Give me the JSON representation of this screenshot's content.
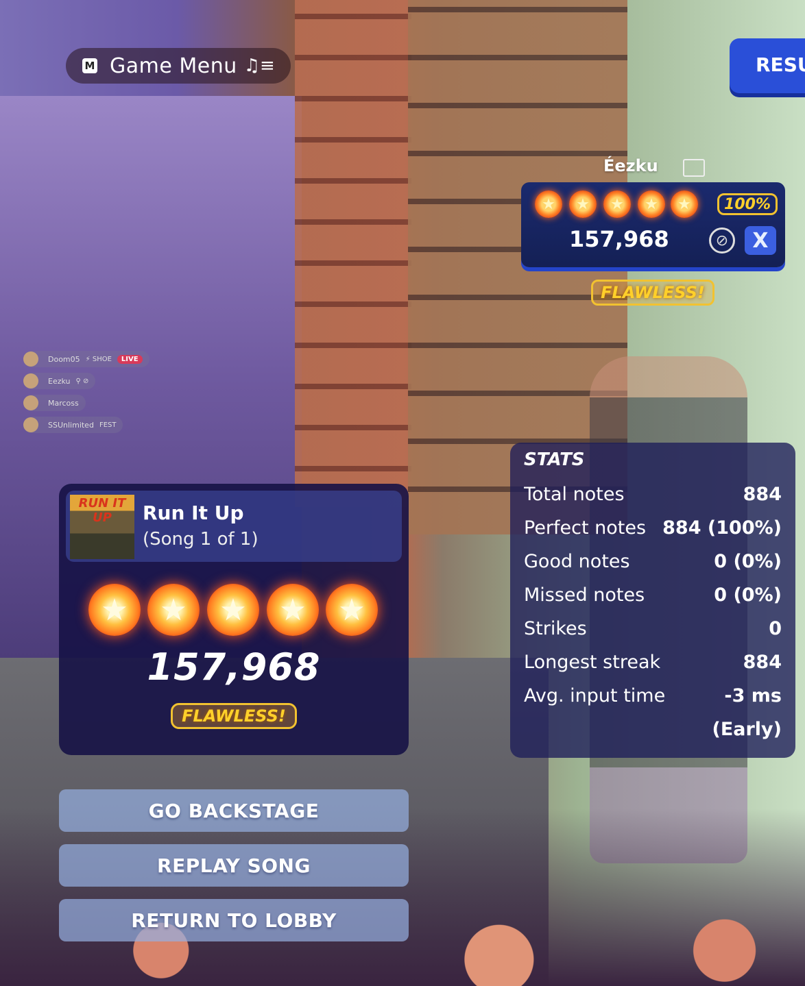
{
  "game_menu": {
    "key": "M",
    "label": "Game Menu"
  },
  "results_tab": {
    "label": "RESU"
  },
  "player": {
    "name": "Éezku",
    "stars": 5,
    "percent": "100%",
    "score": "157,968",
    "close_label": "X",
    "badge": "FLAWLESS!"
  },
  "party": [
    {
      "name": "Doom05",
      "tag": "⚡ SHOE",
      "live": "LIVE"
    },
    {
      "name": "Eezku",
      "tag": "",
      "live": ""
    },
    {
      "name": "Marcoss",
      "tag": "",
      "live": ""
    },
    {
      "name": "SSUnlimited",
      "tag": "FEST",
      "live": ""
    }
  ],
  "song": {
    "album_art_text": "RUN IT UP",
    "title": "Run It Up",
    "subtitle": "(Song 1 of 1)",
    "stars": 5,
    "score": "157,968",
    "badge": "FLAWLESS!"
  },
  "buttons": {
    "backstage": "GO BACKSTAGE",
    "replay": "REPLAY SONG",
    "lobby": "RETURN TO LOBBY"
  },
  "stats": {
    "title": "STATS",
    "rows": [
      {
        "label": "Total notes",
        "value": "884"
      },
      {
        "label": "Perfect notes",
        "value": "884 (100%)"
      },
      {
        "label": "Good notes",
        "value": "0 (0%)"
      },
      {
        "label": "Missed notes",
        "value": "0 (0%)"
      },
      {
        "label": "Strikes",
        "value": "0"
      },
      {
        "label": "Longest streak",
        "value": "884"
      },
      {
        "label": "Avg. input time",
        "value": "-3 ms"
      },
      {
        "label": "",
        "value": "(Early)"
      }
    ]
  },
  "colors": {
    "accent_blue": "#2a4fd8",
    "gold": "#ffd02a",
    "star_orange": "#ff7a20"
  }
}
